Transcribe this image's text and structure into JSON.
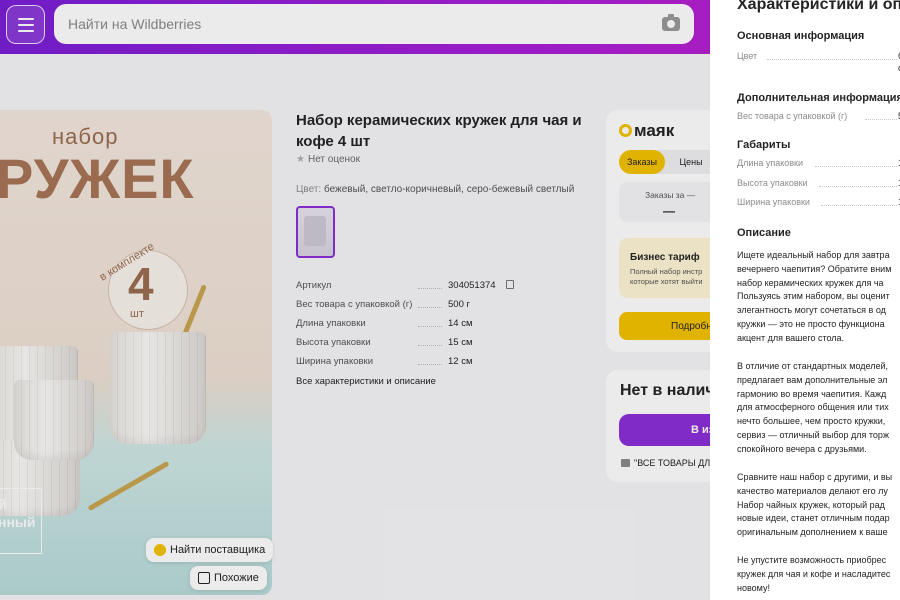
{
  "header": {
    "search_placeholder": "Найти на Wildberries"
  },
  "photo": {
    "line1": "набор",
    "line2": "РУЖЕК",
    "number": "4",
    "unit": "шт",
    "kit": "в комплекте",
    "corner1": "й",
    "corner2": "нный",
    "find_supplier": "Найти поставщика",
    "similar": "Похожие"
  },
  "product": {
    "title": "Набор керамических кружек для чая и кофе 4 шт",
    "rating": "Нет оценок",
    "color_label": "Цвет:",
    "color_value": "бежевый, светло-коричневый, серо-бежевый светлый",
    "specs": [
      {
        "key": "Артикул",
        "value": "304051374"
      },
      {
        "key": "Вес товара с упаковкой (г)",
        "value": "500 г"
      },
      {
        "key": "Длина упаковки",
        "value": "14 см"
      },
      {
        "key": "Высота упаковки",
        "value": "15 см"
      },
      {
        "key": "Ширина упаковки",
        "value": "12 см"
      }
    ],
    "all_link": "Все характеристики и описание"
  },
  "mayak": {
    "logo": "маяк",
    "tab_orders": "Заказы",
    "tab_prices": "Цены",
    "orders_label": "Заказы за —",
    "orders_value": "—",
    "biz_title": "Бизнес тариф",
    "biz_line1": "Полный набор инстр",
    "biz_line2": "которые хотят выйти",
    "biz_button": "Подробн"
  },
  "stock": {
    "title": "Нет в налич",
    "button": "В из",
    "shop": "\"ВСЕ ТОВАРЫ ДЛ"
  },
  "drawer": {
    "title": "Характеристики и оп",
    "sections": {
      "main": "Основная информация",
      "extra": "Дополнительная информация",
      "dims": "Габариты",
      "desc": "Описание"
    },
    "main_rows": [
      {
        "key": "Цвет",
        "value": "б"
      },
      {
        "key": "",
        "value": "с"
      }
    ],
    "extra_rows": [
      {
        "key": "Вес товара с упаковкой (г)",
        "value": "5"
      }
    ],
    "dim_rows": [
      {
        "key": "Длина упаковки",
        "value": "1"
      },
      {
        "key": "Высота упаковки",
        "value": "1"
      },
      {
        "key": "Ширина упаковки",
        "value": "1"
      }
    ],
    "paragraphs": [
      [
        "Ищете идеальный набор для завтра",
        "вечернего чаепития? Обратите вним",
        "набор керамических кружек для ча",
        "Пользуясь этим набором, вы оценит",
        "элегантность могут сочетаться в од",
        "кружки — это не просто функциона",
        "акцент для вашего стола."
      ],
      [
        "В отличие от стандартных моделей,",
        "предлагает вам дополнительные эл",
        "гармонию во время чаепития. Кажд",
        "для атмосферного общения или тих",
        "нечто большее, чем просто кружки,",
        "сервиз — отличный выбор для торж",
        "спокойного вечера с друзьями."
      ],
      [
        "Сравните наш набор с другими, и вы",
        "качество материалов делают его лу",
        "Набор чайных кружек, который рад",
        "новые идеи, станет отличным подар",
        "оригинальным дополнением к ваше"
      ],
      [
        "Не упустите возможность приобрес",
        "кружек для чая и кофе и насладитес",
        "новому!"
      ]
    ]
  }
}
